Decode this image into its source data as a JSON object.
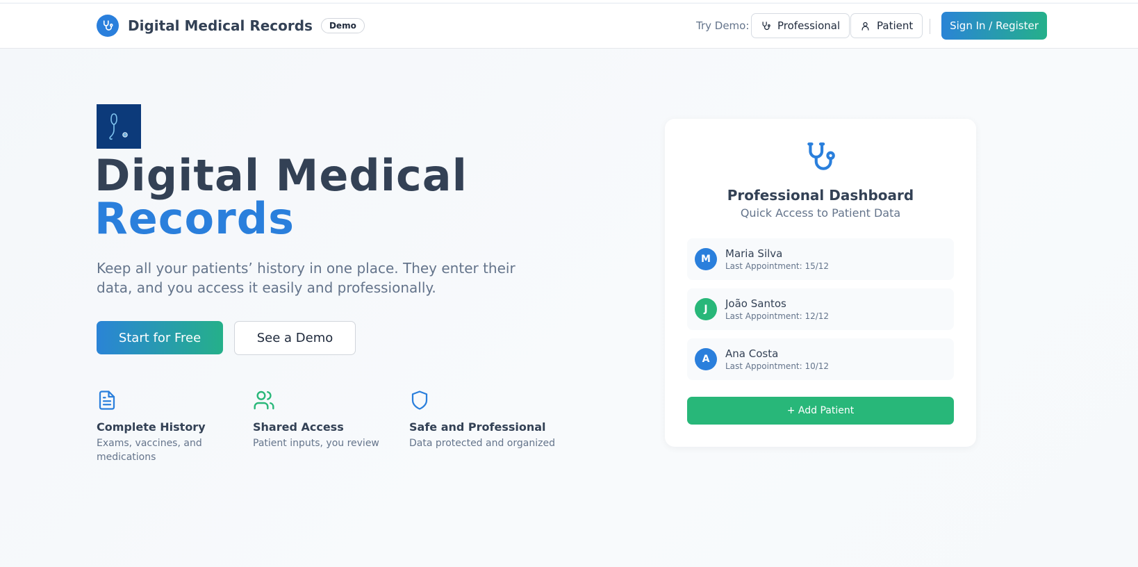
{
  "header": {
    "brand_title": "Digital Medical Records",
    "badge": "Demo",
    "try_label": "Try Demo:",
    "professional_label": "Professional",
    "patient_label": "Patient",
    "signin_label": "Sign In / Register"
  },
  "hero": {
    "title_line1": "Digital Medical",
    "title_line2": "Records",
    "subtitle": "Keep all your patients’ history in one place. They enter their data, and you access it easily and professionally.",
    "cta_primary": "Start for Free",
    "cta_secondary": "See a Demo"
  },
  "features": [
    {
      "icon": "document-icon",
      "title": "Complete History",
      "desc": "Exams, vaccines, and medications"
    },
    {
      "icon": "users-icon",
      "title": "Shared Access",
      "desc": "Patient inputs, you review"
    },
    {
      "icon": "shield-icon",
      "title": "Safe and Professional",
      "desc": "Data protected and organized"
    }
  ],
  "card": {
    "title": "Professional Dashboard",
    "subtitle": "Quick Access to Patient Data",
    "patients": [
      {
        "initial": "M",
        "name": "Maria Silva",
        "last": "Last Appointment: 15/12",
        "color": "#2a7fdc"
      },
      {
        "initial": "J",
        "name": "João Santos",
        "last": "Last Appointment: 12/12",
        "color": "#28b779"
      },
      {
        "initial": "A",
        "name": "Ana Costa",
        "last": "Last Appointment: 10/12",
        "color": "#2a7fdc"
      }
    ],
    "add_label": "+ Add Patient"
  },
  "colors": {
    "primary_blue": "#2a7fdc",
    "accent_green": "#28b779",
    "text_dark": "#334155",
    "text_muted": "#64748b"
  }
}
